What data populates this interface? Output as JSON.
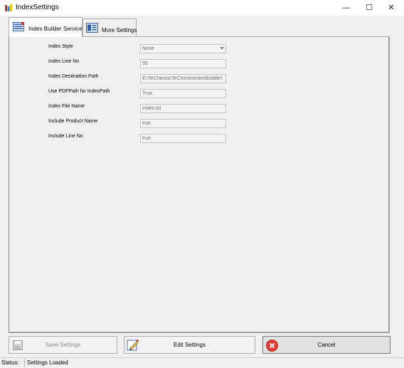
{
  "window": {
    "title": "IndexSettings",
    "minimize": "—",
    "maximize": "☐",
    "close": "✕"
  },
  "tabs": [
    {
      "label": "Index Builder Service",
      "active": true
    },
    {
      "label": "More Settings",
      "active": false
    }
  ],
  "form": [
    {
      "label": "Index Style",
      "value": "None",
      "type": "combo"
    },
    {
      "label": "Index Line No",
      "value": "55",
      "type": "text"
    },
    {
      "label": "Index Destination Path",
      "value": "E:\\TeChecks\\TeChecksIndexBuilder\\",
      "type": "text"
    },
    {
      "label": "Use PDFPath for IndexPath",
      "value": "True",
      "type": "text"
    },
    {
      "label": "Index File Name",
      "value": "Index.txt",
      "type": "text"
    },
    {
      "label": "Include Product Name",
      "value": "true",
      "type": "text"
    },
    {
      "label": "Include Line No",
      "value": "true",
      "type": "text"
    }
  ],
  "buttons": {
    "save": {
      "label": "Save Settings",
      "enabled": false
    },
    "edit": {
      "label": "Edit Settings",
      "enabled": true
    },
    "cancel": {
      "label": "Cancel",
      "enabled": true
    }
  },
  "status": {
    "label": "Status:",
    "value": "Settings Loaded"
  },
  "colors": {
    "cancel_bg": "#e1e1e1",
    "cancel_icon": "#e23b2e",
    "disabled_text": "#8c8c8c"
  }
}
